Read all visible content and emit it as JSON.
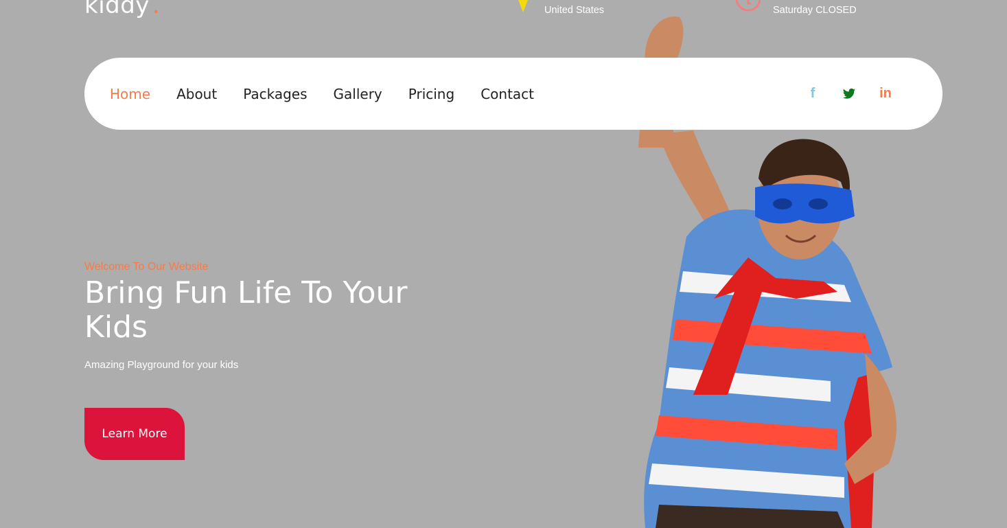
{
  "brand": {
    "name": "kiddy",
    "dot": "."
  },
  "topbar": {
    "address_line": "United States",
    "hours_line": "Saturday CLOSED"
  },
  "nav": {
    "items": [
      "Home",
      "About",
      "Packages",
      "Gallery",
      "Pricing",
      "Contact"
    ],
    "active": "Home"
  },
  "socials": [
    {
      "name": "facebook-icon",
      "glyph": "f",
      "color": "#7ec8e3"
    },
    {
      "name": "twitter-icon",
      "glyph": "t",
      "color": "#0a7a1f"
    },
    {
      "name": "linkedin-icon",
      "glyph": "in",
      "color": "#f47c4b"
    }
  ],
  "hero": {
    "kicker": "Welcome To Our Website",
    "title": "Bring Fun Life To Your Kids",
    "subtitle": "Amazing Playground for your kids",
    "cta": "Learn More"
  },
  "colors": {
    "background": "#adadad",
    "accent": "#f47c4b",
    "button": "#dc143c",
    "pin": "#f5d90a",
    "clock": "#f08080"
  }
}
